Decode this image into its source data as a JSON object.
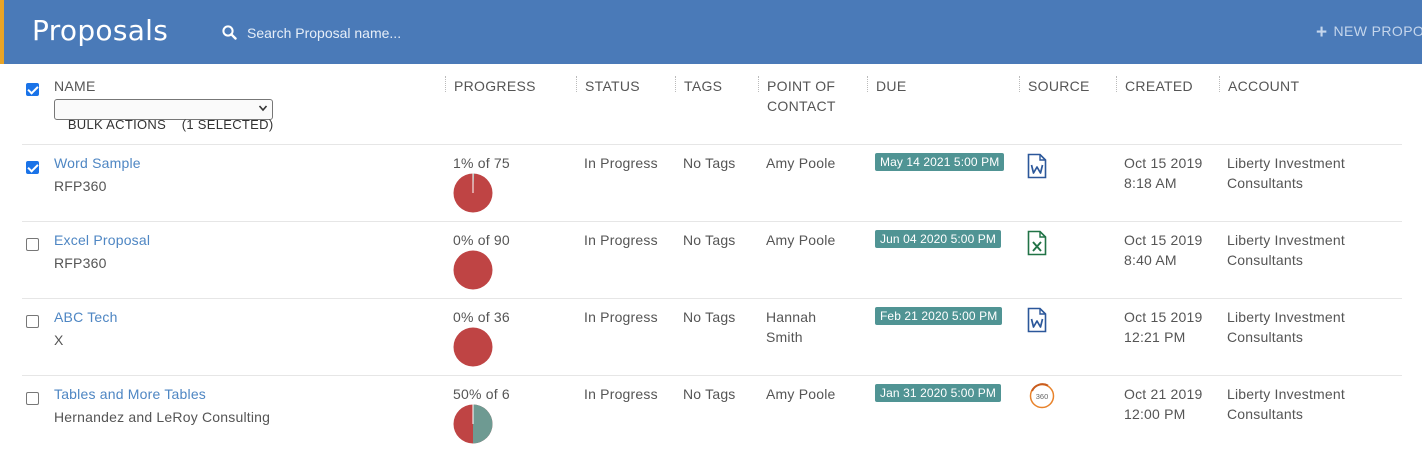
{
  "header": {
    "title": "Proposals",
    "search_placeholder": "Search Proposal name...",
    "new_label": "NEW PROPO",
    "accent": "#e8a427",
    "bar_color": "#4a7ab8"
  },
  "columns": {
    "name": "NAME",
    "progress": "PROGRESS",
    "status": "STATUS",
    "tags": "TAGS",
    "poc_line1": "POINT OF",
    "poc_line2": "CONTACT",
    "due": "DUE",
    "source": "SOURCE",
    "created": "CREATED",
    "account": "ACCOUNT"
  },
  "bulk": {
    "label": "BULK ACTIONS    (1 SELECTED)",
    "select_all_checked": true
  },
  "rows": [
    {
      "checked": true,
      "name": "Word Sample",
      "client": "RFP360",
      "progress_text": "1% of 75",
      "progress_fraction": 0.01,
      "status": "In Progress",
      "tags": "No Tags",
      "poc_line1": "Amy Poole",
      "poc_line2": "",
      "due": "May 14 2021 5:00 PM",
      "source_icon": "word-file-icon",
      "created_date": "Oct 15 2019",
      "created_time": "8:18 AM",
      "account_line1": "Liberty Investment",
      "account_line2": "Consultants"
    },
    {
      "checked": false,
      "name": "Excel Proposal",
      "client": "RFP360",
      "progress_text": "0% of 90",
      "progress_fraction": 0,
      "status": "In Progress",
      "tags": "No Tags",
      "poc_line1": "Amy Poole",
      "poc_line2": "",
      "due": "Jun 04 2020 5:00 PM",
      "source_icon": "excel-file-icon",
      "created_date": "Oct 15 2019",
      "created_time": "8:40 AM",
      "account_line1": "Liberty Investment",
      "account_line2": "Consultants"
    },
    {
      "checked": false,
      "name": "ABC Tech",
      "client": "X",
      "progress_text": "0% of 36",
      "progress_fraction": 0,
      "status": "In Progress",
      "tags": "No Tags",
      "poc_line1": "Hannah",
      "poc_line2": "Smith",
      "due": "Feb 21 2020 5:00 PM",
      "source_icon": "word-file-icon",
      "created_date": "Oct 15 2019",
      "created_time": "12:21 PM",
      "account_line1": "Liberty Investment",
      "account_line2": "Consultants"
    },
    {
      "checked": false,
      "name": "Tables and More Tables",
      "client": "Hernandez and LeRoy Consulting",
      "progress_text": "50% of 6",
      "progress_fraction": 0.5,
      "status": "In Progress",
      "tags": "No Tags",
      "poc_line1": "Amy Poole",
      "poc_line2": "",
      "due": "Jan 31 2020 5:00 PM",
      "source_icon": "rfp360-icon",
      "source_icon_text": "360",
      "created_date": "Oct 21 2019",
      "created_time": "12:00 PM",
      "account_line1": "Liberty Investment",
      "account_line2": "Consultants"
    }
  ],
  "colors": {
    "incomplete": "#bf4444",
    "complete": "#6e9a92",
    "due_badge": "#509494",
    "link": "#4e86c3",
    "word": "#2b579a",
    "excel": "#217346",
    "rfp360": "#e8822a"
  }
}
